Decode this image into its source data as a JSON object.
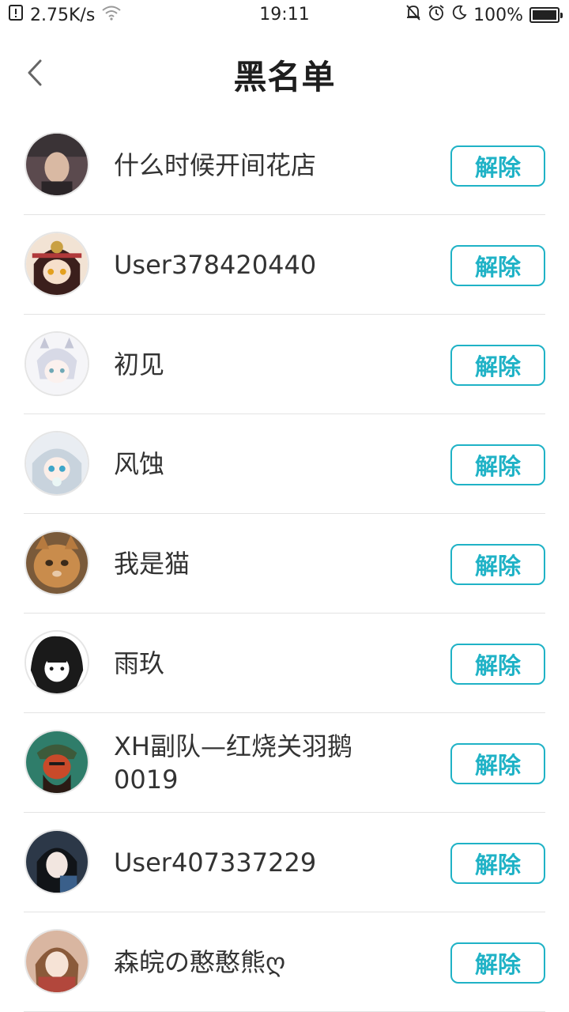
{
  "status_bar": {
    "net_speed": "2.75K/s",
    "time": "19:11",
    "battery": "100%"
  },
  "header": {
    "title": "黑名单"
  },
  "blocklist": [
    {
      "name": "什么时候开间花店",
      "action": "解除",
      "avatar_color": "#5b4a4e"
    },
    {
      "name": "User378420440",
      "action": "解除",
      "avatar_color": "#b0393a"
    },
    {
      "name": "初见",
      "action": "解除",
      "avatar_color": "#d7d9e6"
    },
    {
      "name": "风蚀",
      "action": "解除",
      "avatar_color": "#c8d3dd"
    },
    {
      "name": "我是猫",
      "action": "解除",
      "avatar_color": "#c98c4c"
    },
    {
      "name": "雨玖",
      "action": "解除",
      "avatar_color": "#1a1a1a"
    },
    {
      "name": "XH副队—红烧关羽鹅0019",
      "action": "解除",
      "avatar_color": "#2f7d6a"
    },
    {
      "name": "User407337229",
      "action": "解除",
      "avatar_color": "#2c3848"
    },
    {
      "name": "森皖の憨憨熊ღ",
      "action": "解除",
      "avatar_color": "#d9b6a1"
    }
  ],
  "colors": {
    "accent": "#1fb2c6",
    "divider": "#e3e3e3"
  }
}
